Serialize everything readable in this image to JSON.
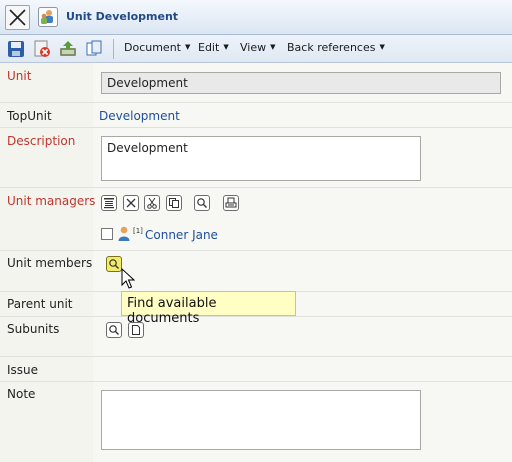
{
  "window": {
    "title": "Unit Development"
  },
  "icons": {
    "close": "close-icon",
    "unit": "unit-icon",
    "save": "save-icon",
    "delete": "delete-icon",
    "export": "export-icon",
    "copy": "copy-icon"
  },
  "toolbar": {
    "menus": [
      "Document",
      "Edit",
      "View",
      "Back references"
    ]
  },
  "form": {
    "unit": {
      "label": "Unit",
      "value": "Development"
    },
    "topunit": {
      "label": "TopUnit",
      "value": "Development"
    },
    "description": {
      "label": "Description",
      "value": "Development"
    },
    "unit_managers": {
      "label": "Unit managers",
      "members": [
        {
          "superscript": "[1]",
          "name": "Conner Jane"
        }
      ]
    },
    "unit_members": {
      "label": "Unit members"
    },
    "parent_unit": {
      "label": "Parent unit"
    },
    "subunits": {
      "label": "Subunits"
    },
    "issue": {
      "label": "Issue"
    },
    "note": {
      "label": "Note",
      "value": ""
    }
  },
  "tooltip": {
    "text": "Find available documents"
  },
  "colors": {
    "required_label": "#c0362c",
    "link": "#1f4f9c",
    "title": "#234a86"
  }
}
